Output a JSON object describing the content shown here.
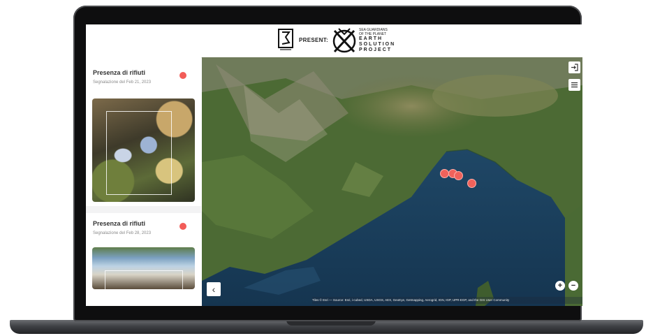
{
  "header": {
    "present_label": "PRESENT:",
    "logo_b_line1": "SEA GUARDIANS",
    "logo_b_line2": "OF THE PLANET",
    "logo_b_big1": "EARTH",
    "logo_b_big2": "SOLUTION",
    "logo_b_big3": "PROJECT"
  },
  "sidebar": {
    "cards": [
      {
        "title": "Presenza di rifiuti",
        "date": "Segnalazione del Feb 21, 2023"
      },
      {
        "title": "Presenza di rifiuti",
        "date": "Segnalazione del Feb 28, 2023"
      }
    ]
  },
  "map": {
    "attribution": "Tiles © Esri — Source: Esri, i-cubed, USDA, USGS, AEX, GeoEye, Getmapping, Aerogrid, IGN, IGP, UPR-EGP, and the GIS User Community",
    "zoom_in": "+",
    "zoom_out": "−",
    "back": "‹",
    "marker_color": "#f0625b"
  },
  "colors": {
    "accent": "#f25c58",
    "sidebar_bg": "#f3f3f4"
  }
}
